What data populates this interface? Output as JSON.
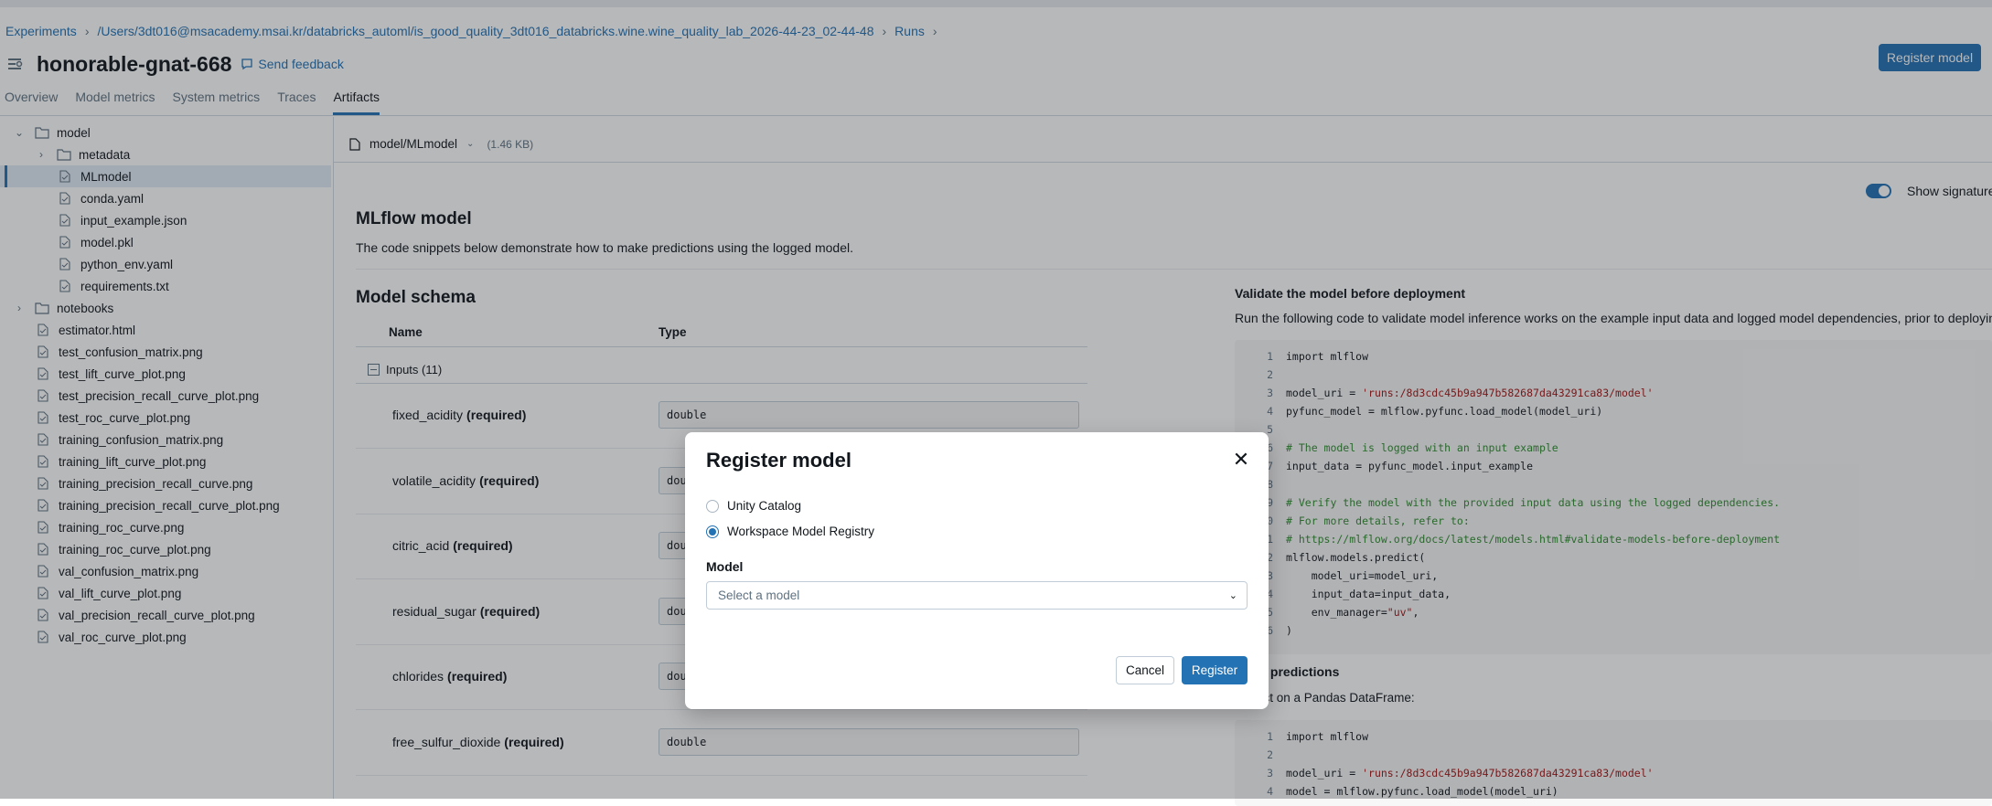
{
  "breadcrumb": [
    "Experiments",
    "/Users/3dt016@msacademy.msai.kr/databricks_automl/is_good_quality_3dt016_databricks.wine.wine_quality_lab_2026-44-23_02-44-48",
    "Runs"
  ],
  "run_title": "honorable-gnat-668",
  "send_feedback": "Send feedback",
  "register_model_button": "Register model",
  "tabs": [
    "Overview",
    "Model metrics",
    "System metrics",
    "Traces",
    "Artifacts"
  ],
  "active_tab": "Artifacts",
  "tree": [
    {
      "label": "model",
      "type": "folder",
      "depth": 0,
      "expanded": true
    },
    {
      "label": "metadata",
      "type": "folder",
      "depth": 1,
      "expanded": false
    },
    {
      "label": "MLmodel",
      "type": "file",
      "depth": 1,
      "selected": true
    },
    {
      "label": "conda.yaml",
      "type": "file",
      "depth": 1
    },
    {
      "label": "input_example.json",
      "type": "file",
      "depth": 1
    },
    {
      "label": "model.pkl",
      "type": "file",
      "depth": 1
    },
    {
      "label": "python_env.yaml",
      "type": "file",
      "depth": 1
    },
    {
      "label": "requirements.txt",
      "type": "file",
      "depth": 1
    },
    {
      "label": "notebooks",
      "type": "folder",
      "depth": 0,
      "expanded": false
    },
    {
      "label": "estimator.html",
      "type": "file",
      "depth": 0
    },
    {
      "label": "test_confusion_matrix.png",
      "type": "file",
      "depth": 0
    },
    {
      "label": "test_lift_curve_plot.png",
      "type": "file",
      "depth": 0
    },
    {
      "label": "test_precision_recall_curve_plot.png",
      "type": "file",
      "depth": 0
    },
    {
      "label": "test_roc_curve_plot.png",
      "type": "file",
      "depth": 0
    },
    {
      "label": "training_confusion_matrix.png",
      "type": "file",
      "depth": 0
    },
    {
      "label": "training_lift_curve_plot.png",
      "type": "file",
      "depth": 0
    },
    {
      "label": "training_precision_recall_curve.png",
      "type": "file",
      "depth": 0
    },
    {
      "label": "training_precision_recall_curve_plot.png",
      "type": "file",
      "depth": 0
    },
    {
      "label": "training_roc_curve.png",
      "type": "file",
      "depth": 0
    },
    {
      "label": "training_roc_curve_plot.png",
      "type": "file",
      "depth": 0
    },
    {
      "label": "val_confusion_matrix.png",
      "type": "file",
      "depth": 0
    },
    {
      "label": "val_lift_curve_plot.png",
      "type": "file",
      "depth": 0
    },
    {
      "label": "val_precision_recall_curve_plot.png",
      "type": "file",
      "depth": 0
    },
    {
      "label": "val_roc_curve_plot.png",
      "type": "file",
      "depth": 0
    }
  ],
  "artifact": {
    "path": "model/MLmodel",
    "size": "(1.46 KB)"
  },
  "mlflow": {
    "title": "MLflow model",
    "desc": "The code snippets below demonstrate how to make predictions using the logged model.",
    "show_signature": "Show signature a"
  },
  "schema": {
    "title": "Model schema",
    "col_name": "Name",
    "col_type": "Type",
    "inputs_label": "Inputs (11)",
    "required": "(required)",
    "fields": [
      {
        "name": "fixed_acidity",
        "type": "double"
      },
      {
        "name": "volatile_acidity",
        "type": "dou"
      },
      {
        "name": "citric_acid",
        "type": "dou"
      },
      {
        "name": "residual_sugar",
        "type": "dou"
      },
      {
        "name": "chlorides",
        "type": "dou"
      },
      {
        "name": "free_sulfur_dioxide",
        "type": "double"
      }
    ]
  },
  "validate": {
    "title": "Validate the model before deployment",
    "desc": "Run the following code to validate model inference works on the example input data and logged model dependencies, prior to deploying it to a",
    "code": [
      {
        "n": "1",
        "t": "import mlflow",
        "k": ""
      },
      {
        "n": "2",
        "t": "",
        "k": ""
      },
      {
        "n": "3",
        "t": "model_uri = 'runs:/8d3cdc45b9a947b582687da43291ca83/model'",
        "k": "uri"
      },
      {
        "n": "4",
        "t": "pyfunc_model = mlflow.pyfunc.load_model(model_uri)",
        "k": ""
      },
      {
        "n": "5",
        "t": "",
        "k": ""
      },
      {
        "n": "6",
        "t": "# The model is logged with an input example",
        "k": "cm"
      },
      {
        "n": "7",
        "t": "input_data = pyfunc_model.input_example",
        "k": ""
      },
      {
        "n": "8",
        "t": "",
        "k": ""
      },
      {
        "n": "9",
        "t": "# Verify the model with the provided input data using the logged dependencies.",
        "k": "cm"
      },
      {
        "n": "10",
        "t": "# For more details, refer to:",
        "k": "cm"
      },
      {
        "n": "11",
        "t": "# https://mlflow.org/docs/latest/models.html#validate-models-before-deployment",
        "k": "cm"
      },
      {
        "n": "12",
        "t": "mlflow.models.predict(",
        "k": ""
      },
      {
        "n": "13",
        "t": "    model_uri=model_uri,",
        "k": ""
      },
      {
        "n": "14",
        "t": "    input_data=input_data,",
        "k": ""
      },
      {
        "n": "15",
        "t": "    env_manager=\"uv\",",
        "k": "uv"
      },
      {
        "n": "16",
        "t": ")",
        "k": ""
      }
    ]
  },
  "predictions": {
    "title": "Make predictions",
    "desc": "Predict on a Pandas DataFrame:",
    "code": [
      {
        "n": "1",
        "t": "import mlflow",
        "k": ""
      },
      {
        "n": "2",
        "t": "",
        "k": ""
      },
      {
        "n": "3",
        "t": "model_uri = 'runs:/8d3cdc45b9a947b582687da43291ca83/model'",
        "k": "uri"
      },
      {
        "n": "4",
        "t": "model = mlflow.pyfunc.load_model(model_uri)",
        "k": ""
      }
    ]
  },
  "modal": {
    "title": "Register model",
    "options": [
      "Unity Catalog",
      "Workspace Model Registry"
    ],
    "selected": "Workspace Model Registry",
    "model_label": "Model",
    "select_placeholder": "Select a model",
    "cancel": "Cancel",
    "register": "Register"
  },
  "colors": {
    "accent": "#2272b4",
    "overlay": "rgba(30,35,40,0.32)"
  }
}
